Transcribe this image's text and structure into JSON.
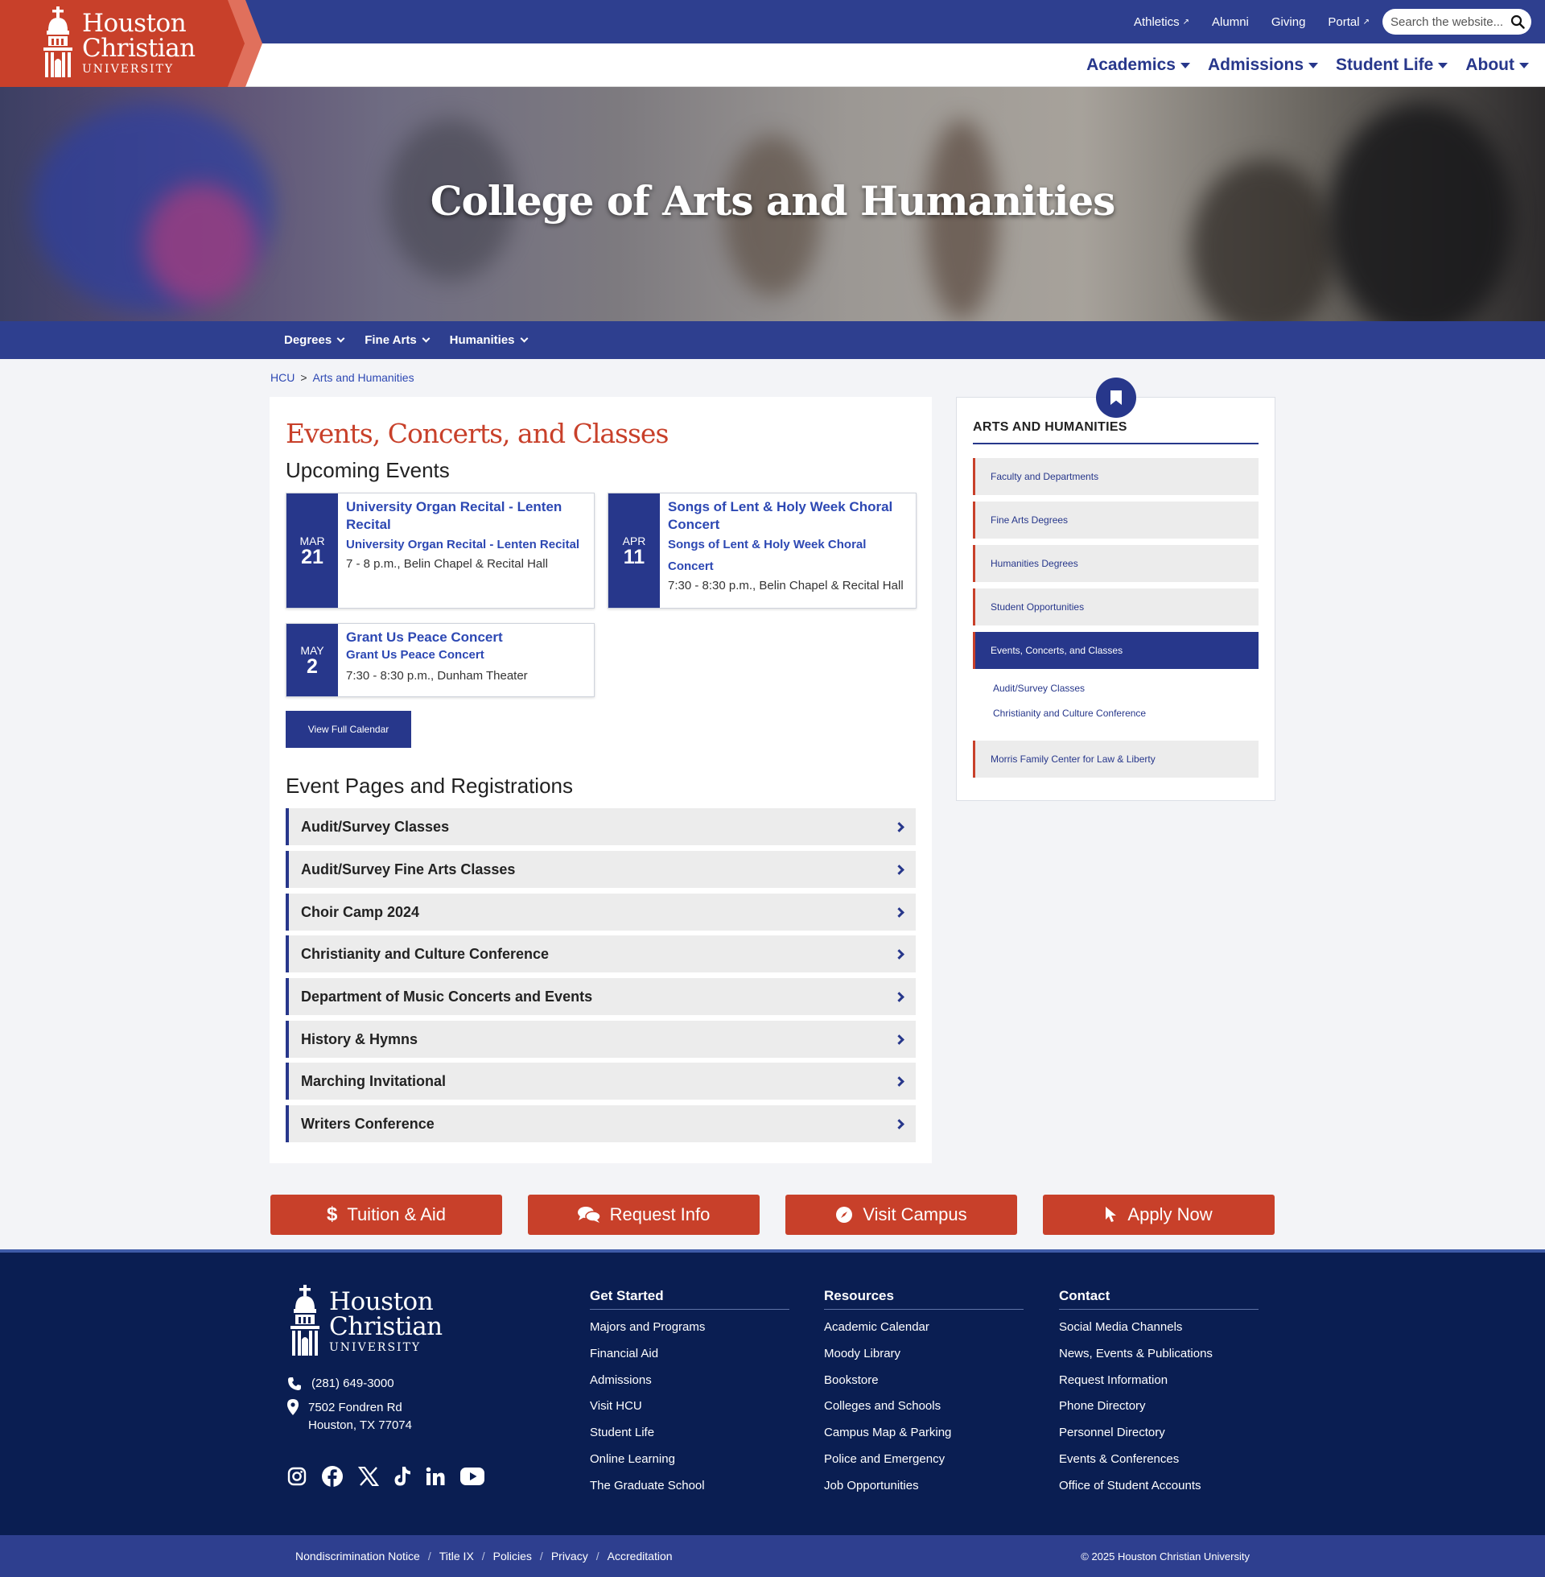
{
  "brand": {
    "name_line1": "Houston",
    "name_line2": "Christian",
    "name_line3": "UNIVERSITY",
    "accent_red": "#c8402a",
    "navy": "#27378b",
    "footer_bg": "#0a1e52"
  },
  "top_links": [
    {
      "label": "Athletics",
      "external": true
    },
    {
      "label": "Alumni",
      "external": false
    },
    {
      "label": "Giving",
      "external": false
    },
    {
      "label": "Portal",
      "external": true
    }
  ],
  "search": {
    "placeholder": "Search the website..."
  },
  "main_nav": [
    "Academics",
    "Admissions",
    "Student Life",
    "About"
  ],
  "hero": {
    "title": "College of Arts and Humanities"
  },
  "sub_nav": [
    "Degrees",
    "Fine Arts",
    "Humanities"
  ],
  "breadcrumb": {
    "home": "HCU",
    "separator": ">",
    "current": "Arts and Humanities"
  },
  "main": {
    "title": "Events, Concerts, and Classes",
    "upcoming_heading": "Upcoming Events",
    "events": [
      {
        "month": "MAR",
        "day": "21",
        "title": "University Organ Recital - Lenten Recital",
        "subtitle": "University Organ Recital - Lenten Recital",
        "when": "7 - 8 p.m., Belin Chapel & Recital Hall"
      },
      {
        "month": "APR",
        "day": "11",
        "title": "Songs of Lent & Holy Week Choral Concert",
        "subtitle": "Songs of Lent & Holy Week Choral Concert",
        "when": "7:30 - 8:30 p.m., Belin Chapel & Recital Hall"
      },
      {
        "month": "MAY",
        "day": "2",
        "title": "Grant Us Peace Concert",
        "subtitle": "Grant Us Peace Concert",
        "when": "7:30 - 8:30 p.m., Dunham Theater"
      }
    ],
    "calendar_button": "View Full Calendar",
    "registrations_heading": "Event Pages and Registrations",
    "registrations": [
      "Audit/Survey Classes",
      "Audit/Survey Fine Arts Classes",
      "Choir Camp 2024",
      "Christianity and Culture Conference",
      "Department of Music Concerts and Events",
      "History & Hymns",
      "Marching Invitational",
      "Writers Conference"
    ]
  },
  "sidebar": {
    "heading": "ARTS AND HUMANITIES",
    "items": [
      "Faculty and Departments",
      "Fine Arts Degrees",
      "Humanities Degrees",
      "Student Opportunities",
      "Events, Concerts, and Classes"
    ],
    "active_index": 4,
    "subitems": [
      "Audit/Survey Classes",
      "Christianity and Culture Conference"
    ],
    "last_item": "Morris Family Center for Law & Liberty"
  },
  "cta": [
    {
      "label": "Tuition & Aid",
      "icon": "dollar-icon"
    },
    {
      "label": "Request Info",
      "icon": "chat-icon"
    },
    {
      "label": "Visit Campus",
      "icon": "compass-icon"
    },
    {
      "label": "Apply Now",
      "icon": "pointer-icon"
    }
  ],
  "footer": {
    "phone": "(281) 649-3000",
    "address_line1": "7502 Fondren Rd",
    "address_line2": "Houston, TX 77074",
    "socials": [
      "instagram-icon",
      "facebook-icon",
      "x-icon",
      "tiktok-icon",
      "linkedin-icon",
      "youtube-icon"
    ],
    "columns": [
      {
        "heading": "Get Started",
        "links": [
          "Majors and Programs",
          "Financial Aid",
          "Admissions",
          "Visit HCU",
          "Student Life",
          "Online Learning",
          "The Graduate School"
        ]
      },
      {
        "heading": "Resources",
        "links": [
          "Academic Calendar",
          "Moody Library",
          "Bookstore",
          "Colleges and Schools",
          "Campus Map & Parking",
          "Police and Emergency",
          "Job Opportunities"
        ]
      },
      {
        "heading": "Contact",
        "links": [
          "Social Media Channels",
          "News, Events & Publications",
          "Request Information",
          "Phone Directory",
          "Personnel Directory",
          "Events & Conferences",
          "Office of Student Accounts"
        ]
      }
    ],
    "legal": [
      "Nondiscrimination Notice",
      "Title IX",
      "Policies",
      "Privacy",
      "Accreditation"
    ],
    "legal_separator": "/",
    "copyright": "© 2025 Houston Christian University"
  }
}
